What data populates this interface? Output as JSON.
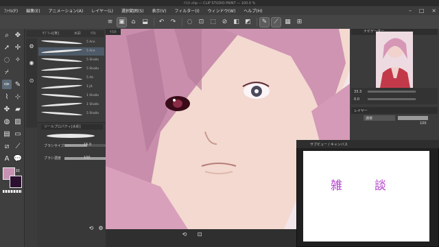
{
  "window": {
    "title": "ｲﾗｽﾄ.clip ― CLIP STUDIO PAINT ― 100.0 %"
  },
  "menu": {
    "items": [
      "ﾌｧｲﾙ(F)",
      "編集(E)",
      "アニメーション(A)",
      "レイヤー(L)",
      "選択範囲(S)",
      "表示(V)",
      "フィルター(I)",
      "ウィンドウ(W)",
      "ヘルプ(H)"
    ]
  },
  "subtool": {
    "tabs": [
      "ｻﾌﾞﾂｰﾙ[筆]",
      "水彩",
      "ﾘｱﾙ"
    ],
    "brushes": [
      "5 Ace",
      "5 Ace",
      "5 Shallo",
      "5 Shallo",
      "5 Ah",
      "1 Jit",
      "1 Shallo",
      "1 Shallo",
      "5 Shallo"
    ]
  },
  "properties": {
    "title": "ツールプロパティ[水彩]",
    "brush_size_label": "ブラシサイズ",
    "brush_size_value": "15.0",
    "density_label": "ブラシ濃度",
    "density_value": "100",
    "brush_size_level": 0.55,
    "density_level": 1.0
  },
  "canvas": {
    "tab_label": "ｲﾗｽﾄ"
  },
  "navigator": {
    "title": "ナビゲーター",
    "zoom": "33.3",
    "angle": "0.0"
  },
  "layer": {
    "title": "レイヤー",
    "blend_mode": "通常",
    "opacity": "100"
  },
  "popup": {
    "title": "サブビュー / キャンバス",
    "kanji": [
      "雑",
      "談"
    ]
  },
  "colors": {
    "main": "#c792b3",
    "sub": "#2c1030",
    "accent": "#b33fcc"
  }
}
